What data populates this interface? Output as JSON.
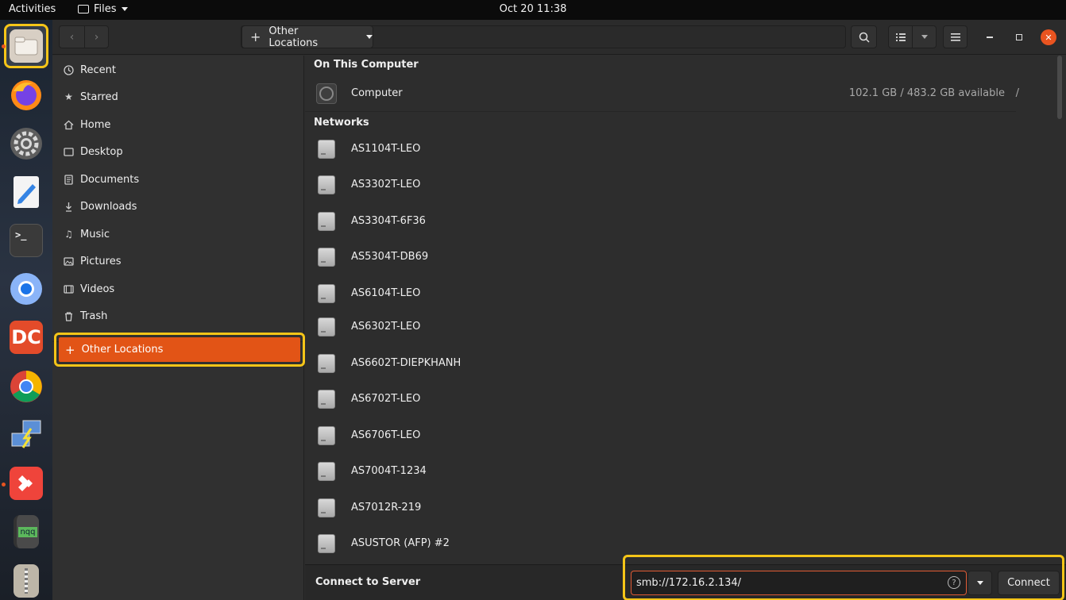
{
  "topbar": {
    "activities": "Activities",
    "app_menu": "Files",
    "clock": "Oct 20  11:38"
  },
  "dock": {
    "items": [
      {
        "name": "files",
        "icon": "folder-icon",
        "active": true,
        "running": true
      },
      {
        "name": "firefox",
        "icon": "firefox-icon",
        "active": false,
        "running": false
      },
      {
        "name": "settings",
        "icon": "gear-icon",
        "active": false,
        "running": false
      },
      {
        "name": "text-editor",
        "icon": "pencil-icon",
        "active": false,
        "running": false
      },
      {
        "name": "terminal",
        "icon": "terminal-icon",
        "active": false,
        "running": false
      },
      {
        "name": "chromium",
        "icon": "chromium-icon",
        "active": false,
        "running": false
      },
      {
        "name": "doublecmd",
        "icon": "dc-icon",
        "active": false,
        "running": false
      },
      {
        "name": "chrome",
        "icon": "chrome-icon",
        "active": false,
        "running": false
      },
      {
        "name": "network",
        "icon": "network-icon",
        "active": false,
        "running": false
      },
      {
        "name": "anydesk",
        "icon": "anydesk-icon",
        "active": false,
        "running": true
      },
      {
        "name": "notes",
        "icon": "notebook-icon",
        "active": false,
        "running": false,
        "label": "nqq"
      },
      {
        "name": "archive",
        "icon": "archive-icon",
        "active": false,
        "running": false
      }
    ]
  },
  "headerbar": {
    "location_label": "Other Locations",
    "location_icon": "plus-icon"
  },
  "sidebar": {
    "items": [
      {
        "label": "Recent",
        "icon": "clock-icon"
      },
      {
        "label": "Starred",
        "icon": "star-icon"
      },
      {
        "label": "Home",
        "icon": "home-icon"
      },
      {
        "label": "Desktop",
        "icon": "desktop-icon"
      },
      {
        "label": "Documents",
        "icon": "document-icon"
      },
      {
        "label": "Downloads",
        "icon": "download-icon"
      },
      {
        "label": "Music",
        "icon": "music-icon"
      },
      {
        "label": "Pictures",
        "icon": "picture-icon"
      },
      {
        "label": "Videos",
        "icon": "video-icon"
      },
      {
        "label": "Trash",
        "icon": "trash-icon"
      }
    ],
    "active_item": {
      "label": "Other Locations",
      "icon": "plus-icon"
    }
  },
  "main": {
    "on_this_computer_title": "On This Computer",
    "computer": {
      "name": "Computer",
      "available": "102.1 GB / 483.2 GB available",
      "mount": "/"
    },
    "networks_title": "Networks",
    "networks": [
      "AS1104T-LEO",
      "AS3302T-LEO",
      "AS3304T-6F36",
      "AS5304T-DB69",
      "AS6104T-LEO",
      "AS6302T-LEO",
      "AS6602T-DIEPKHANH",
      "AS6702T-LEO",
      "AS6706T-LEO",
      "AS7004T-1234",
      "AS7012R-219",
      "ASUSTOR (AFP) #2"
    ]
  },
  "connect": {
    "label": "Connect to Server",
    "value": "smb://172.16.2.134/",
    "button": "Connect"
  },
  "colors": {
    "accent": "#e95420",
    "highlight": "#f5c518"
  }
}
